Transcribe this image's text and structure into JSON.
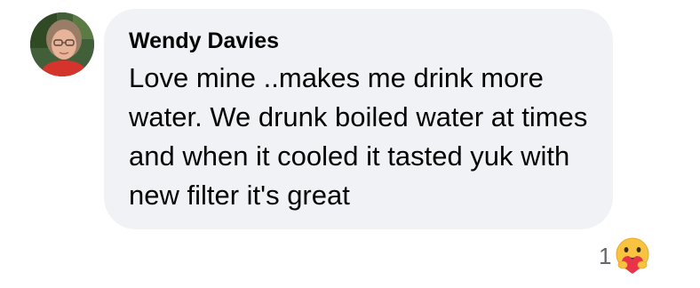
{
  "comment": {
    "author": "Wendy Davies",
    "text": "Love mine ..makes me drink more water. We drunk boiled water at times and when it cooled it tasted yuk with new filter it's great",
    "avatar_icon": "avatar-photo",
    "reactions": {
      "count": "1",
      "icon": "care-emoji-icon"
    }
  },
  "colors": {
    "bubble_bg": "#f0f2f5",
    "text": "#050505",
    "secondary_text": "#65676b"
  }
}
